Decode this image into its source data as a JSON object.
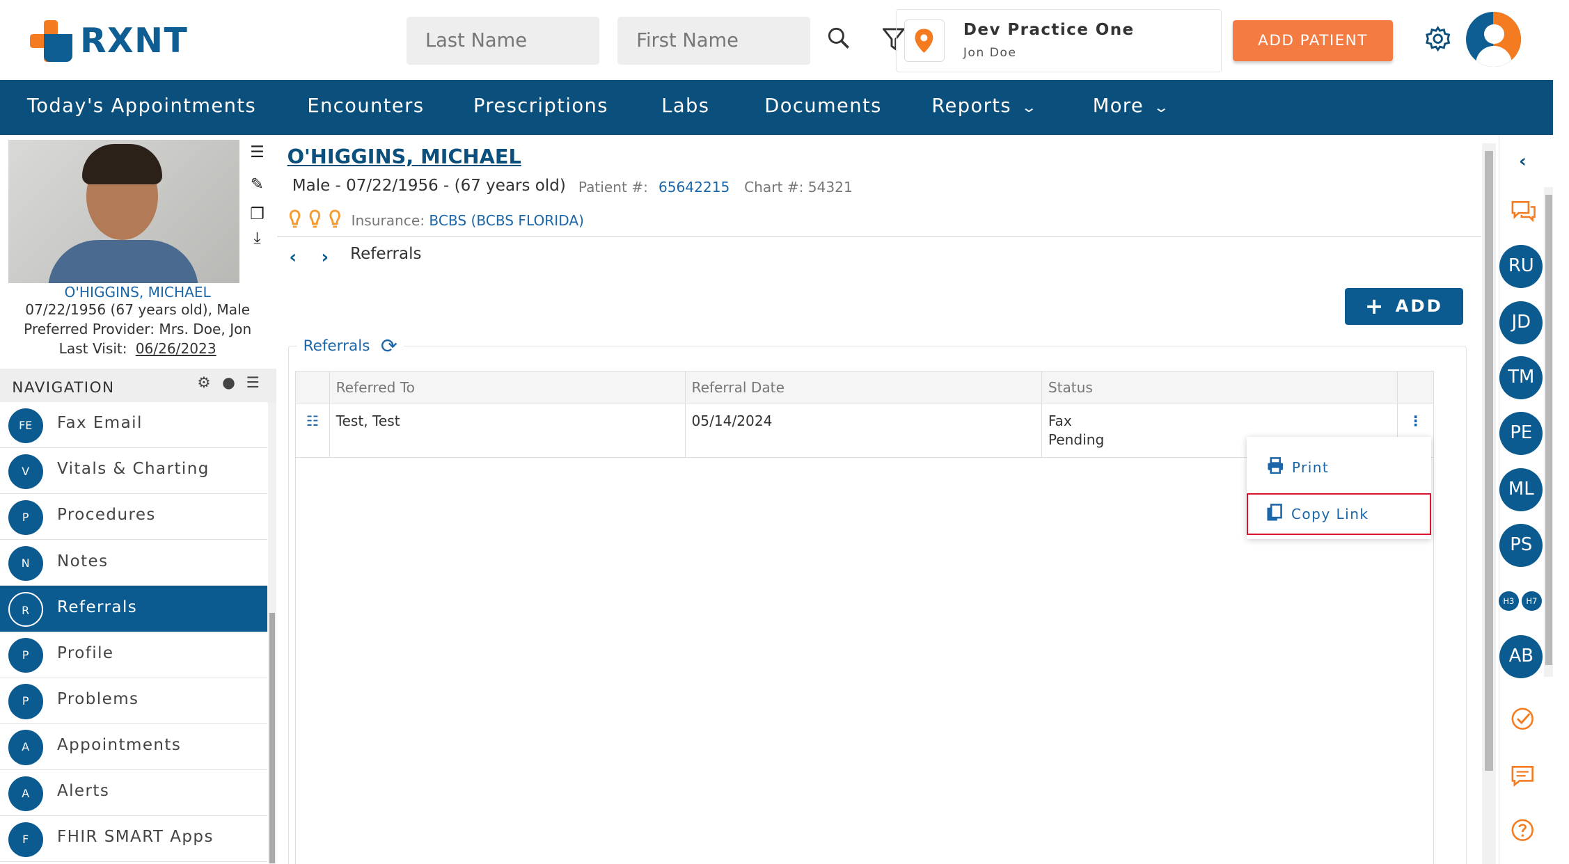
{
  "app": {
    "logo_text": "RXNT"
  },
  "search": {
    "last_name_placeholder": "Last Name",
    "first_name_placeholder": "First Name"
  },
  "practice": {
    "name": "Dev Practice One",
    "user": "Jon Doe"
  },
  "header": {
    "add_patient": "ADD PATIENT"
  },
  "nav": {
    "items": [
      {
        "label": "Today's Appointments"
      },
      {
        "label": "Encounters"
      },
      {
        "label": "Prescriptions"
      },
      {
        "label": "Labs"
      },
      {
        "label": "Documents"
      },
      {
        "label": "Reports"
      },
      {
        "label": "More"
      }
    ]
  },
  "patient": {
    "name": "O'HIGGINS, MICHAEL",
    "dob_line": "07/22/1956 (67 years old), Male",
    "provider_line": "Preferred Provider: Mrs. Doe, Jon",
    "last_visit_label": "Last Visit:",
    "last_visit": "06/26/2023",
    "demo": "Male - 07/22/1956 - (67 years old)",
    "patient_no_label": "Patient #:",
    "patient_no": "65642215",
    "chart_no": "Chart #: 54321",
    "insurance_label": "Insurance:",
    "insurance": "BCBS (BCBS FLORIDA)"
  },
  "sidenav": {
    "title": "NAVIGATION",
    "items": [
      {
        "abbr": "FE",
        "label": "Fax Email"
      },
      {
        "abbr": "V",
        "label": "Vitals & Charting"
      },
      {
        "abbr": "P",
        "label": "Procedures"
      },
      {
        "abbr": "N",
        "label": "Notes"
      },
      {
        "abbr": "R",
        "label": "Referrals",
        "active": true
      },
      {
        "abbr": "P",
        "label": "Profile"
      },
      {
        "abbr": "P",
        "label": "Problems"
      },
      {
        "abbr": "A",
        "label": "Appointments"
      },
      {
        "abbr": "A",
        "label": "Alerts"
      },
      {
        "abbr": "F",
        "label": "FHIR SMART Apps"
      }
    ]
  },
  "page": {
    "breadcrumb": "Referrals",
    "add_label": "ADD",
    "section_title": "Referrals"
  },
  "table": {
    "headers": [
      "Referred To",
      "Referral Date",
      "Status"
    ],
    "rows": [
      {
        "referred_to": "Test, Test",
        "date": "05/14/2024",
        "status_line1": "Fax",
        "status_line2": "Pending"
      }
    ]
  },
  "menu": {
    "print": "Print",
    "copy_link": "Copy Link"
  },
  "rail": {
    "bubbles": [
      "RU",
      "JD",
      "TM",
      "PE",
      "ML",
      "PS"
    ],
    "minis": [
      "H3",
      "H7"
    ],
    "last": "AB"
  },
  "colors": {
    "brand_blue": "#0b4f7c",
    "accent_orange": "#f47b42",
    "highlight_red": "#d9142e"
  }
}
